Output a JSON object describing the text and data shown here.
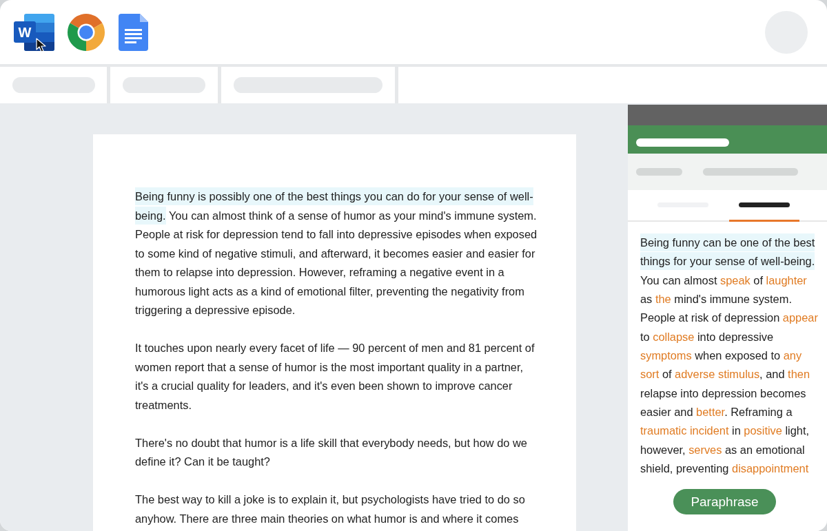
{
  "app_bar": {
    "apps": [
      {
        "kind": "word",
        "letter": "W"
      },
      {
        "kind": "chrome"
      },
      {
        "kind": "docs"
      }
    ]
  },
  "document": {
    "paragraphs": [
      {
        "segments": [
          {
            "kind": "highlight",
            "text": "Being funny is possibly one of the best things you can do for your sense of well-being."
          },
          {
            "kind": "plain",
            "text": " You can almost think of a sense of humor as your mind's immune system. People at risk for depression tend to fall into depressive episodes when exposed to some kind of negative stimuli, and afterward, it becomes easier and easier for them to relapse into depression. However, reframing a negative event in a humorous light acts as a kind of emotional filter, preventing the negativity from triggering a depressive episode."
          }
        ]
      },
      {
        "segments": [
          {
            "kind": "plain",
            "text": "It touches upon nearly every facet of life — 90 percent of men and 81 percent of women report that a sense of humor is the most important quality in a partner, it's a crucial quality for leaders, and it's even been shown to improve cancer treatments."
          }
        ]
      },
      {
        "segments": [
          {
            "kind": "plain",
            "text": "There's no doubt that humor is a life skill that everybody needs, but how do we define it? Can it be taught?"
          }
        ]
      },
      {
        "segments": [
          {
            "kind": "plain",
            "text": "The best way to kill a joke is to explain it, but psychologists have tried to do so anyhow. There are three main theories on what humor is and where it comes"
          }
        ]
      }
    ]
  },
  "panel": {
    "tabs": [
      {
        "selected": false
      },
      {
        "selected": true
      }
    ],
    "segments": [
      {
        "kind": "highlight",
        "text": "Being funny can be one of the best things for your sense of well-being."
      },
      {
        "kind": "plain",
        "text": " You can almost "
      },
      {
        "kind": "changed",
        "text": "speak"
      },
      {
        "kind": "plain",
        "text": " of "
      },
      {
        "kind": "changed",
        "text": "laughter"
      },
      {
        "kind": "plain",
        "text": " as "
      },
      {
        "kind": "changed",
        "text": "the"
      },
      {
        "kind": "plain",
        "text": " mind's immune system. People at risk of depression "
      },
      {
        "kind": "changed",
        "text": "appear"
      },
      {
        "kind": "plain",
        "text": " to "
      },
      {
        "kind": "changed",
        "text": "collapse"
      },
      {
        "kind": "plain",
        "text": " into depressive "
      },
      {
        "kind": "changed",
        "text": "symptoms"
      },
      {
        "kind": "plain",
        "text": " when exposed to "
      },
      {
        "kind": "changed",
        "text": "any sort"
      },
      {
        "kind": "plain",
        "text": " of "
      },
      {
        "kind": "changed",
        "text": "adverse stimulus"
      },
      {
        "kind": "plain",
        "text": ", and "
      },
      {
        "kind": "changed",
        "text": "then"
      },
      {
        "kind": "plain",
        "text": " relapse into depression becomes easier and "
      },
      {
        "kind": "changed",
        "text": "better"
      },
      {
        "kind": "plain",
        "text": ". Reframing a "
      },
      {
        "kind": "changed",
        "text": "traumatic incident"
      },
      {
        "kind": "plain",
        "text": " in "
      },
      {
        "kind": "changed",
        "text": "positive"
      },
      {
        "kind": "plain",
        "text": " light, however, "
      },
      {
        "kind": "changed",
        "text": "serves"
      },
      {
        "kind": "plain",
        "text": " as an emotional shield, preventing "
      },
      {
        "kind": "changed",
        "text": "disappointment"
      }
    ],
    "button": "Paraphrase"
  }
}
